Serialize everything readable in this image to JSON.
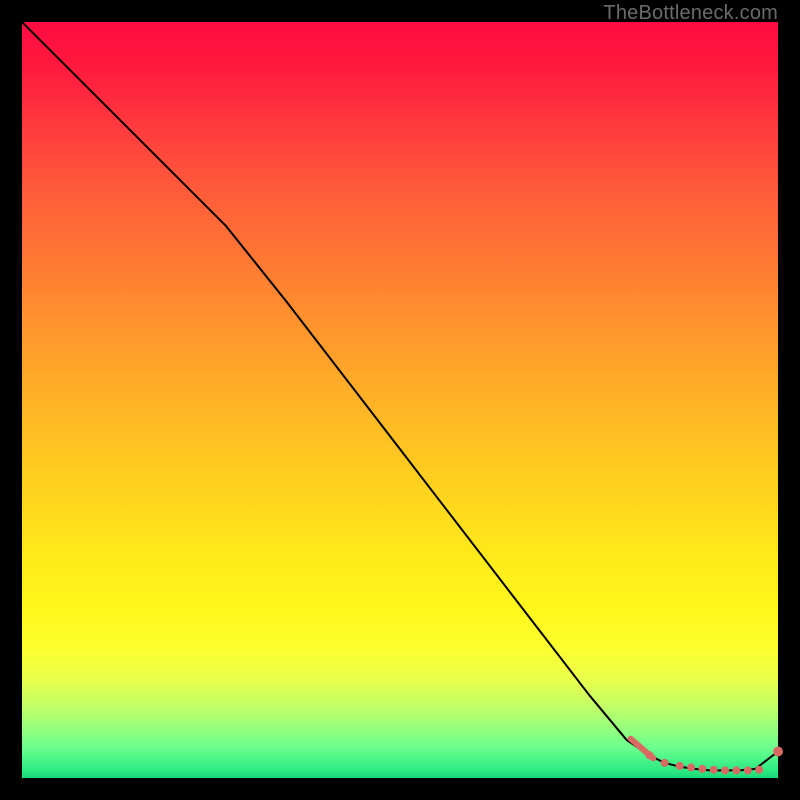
{
  "watermark": "TheBottleneck.com",
  "colors": {
    "page_bg": "#000000",
    "line": "#000000",
    "markers": "#d96a63"
  },
  "chart_data": {
    "type": "line",
    "title": "",
    "xlabel": "",
    "ylabel": "",
    "xlim": [
      0,
      100
    ],
    "ylim": [
      0,
      100
    ],
    "grid": false,
    "legend": false,
    "series": [
      {
        "name": "curve",
        "x": [
          0,
          10,
          20,
          27,
          35,
          45,
          55,
          65,
          75,
          80,
          83,
          85,
          87,
          89,
          91,
          93,
          95,
          97,
          100
        ],
        "y": [
          100,
          90,
          80,
          73,
          63,
          50,
          37,
          24,
          11,
          5,
          3,
          2,
          1.5,
          1.2,
          1.0,
          1.0,
          1.0,
          1.2,
          3.5
        ]
      }
    ],
    "markers": {
      "name": "highlight-points",
      "x": [
        83,
        85,
        87,
        88.5,
        90,
        91.5,
        93,
        94.5,
        96,
        97.5,
        100
      ],
      "y": [
        3.0,
        2.0,
        1.6,
        1.4,
        1.2,
        1.1,
        1.0,
        1.0,
        1.0,
        1.1,
        3.5
      ]
    },
    "marker_segment": {
      "name": "thick-descent",
      "x": [
        80.5,
        83.5
      ],
      "y": [
        5.2,
        2.6
      ]
    }
  }
}
